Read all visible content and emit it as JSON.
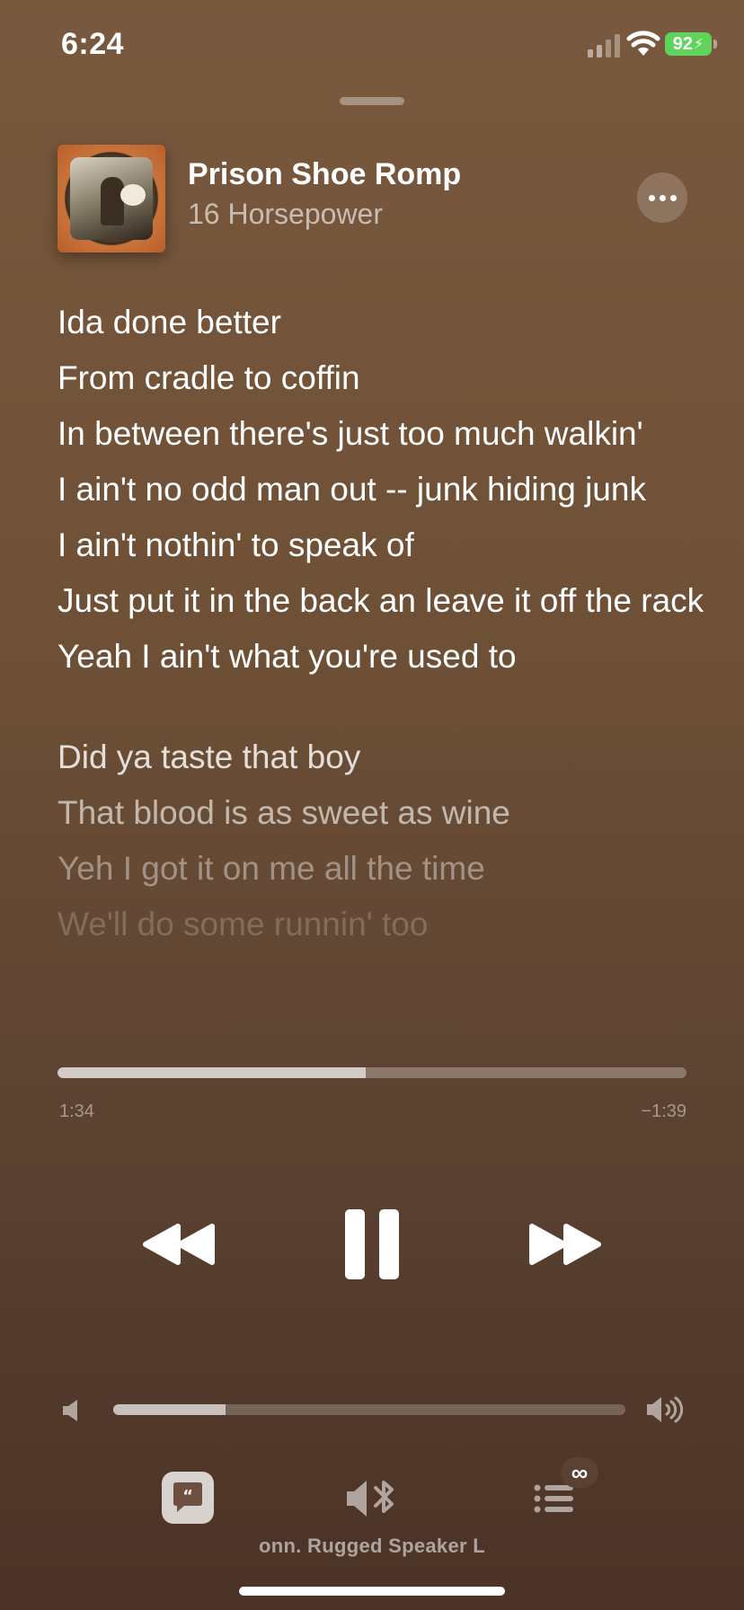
{
  "status_bar": {
    "time": "6:24",
    "battery": "92"
  },
  "now_playing": {
    "title": "Prison Shoe Romp",
    "artist": "16 Horsepower",
    "more_icon": "ellipsis-icon"
  },
  "lyrics": {
    "lines": [
      "Ida done better",
      "From cradle to coffin",
      "In between there's just too much walkin'",
      "I ain't no odd man out -- junk hiding junk",
      "I ain't nothin' to speak of",
      "Just put it in the back an leave it off the rack",
      "Yeah I ain't what you're used to"
    ],
    "upcoming": [
      "Did ya taste that boy",
      "That blood is as sweet as wine",
      "Yeh I got it on me all the time",
      "We'll do some runnin' too"
    ]
  },
  "playback": {
    "elapsed": "1:34",
    "remaining": "−1:39",
    "progress": 0.49
  },
  "volume": {
    "level": 0.22
  },
  "bottom_bar": {
    "route_label": "onn. Rugged Speaker L",
    "queue_badge": "∞"
  },
  "colors": {
    "background_top": "#79593e",
    "background_bottom": "#4a3226",
    "battery_green": "#5fd35b"
  }
}
